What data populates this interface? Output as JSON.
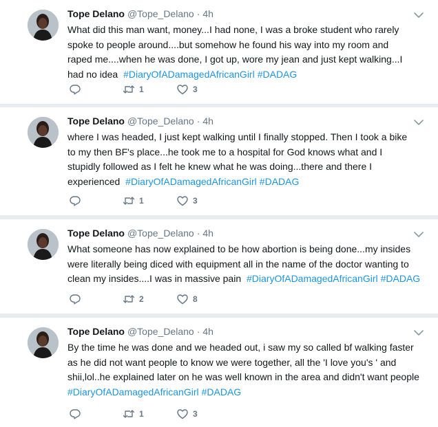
{
  "colors": {
    "name": "#14171a",
    "meta": "#657786",
    "hashtag": "#1b95e0",
    "divider": "#e6ecf0"
  },
  "tweets": [
    {
      "name": "Tope Delano",
      "handle": "@Tope_Delano",
      "separator": "·",
      "time": "4h",
      "text": "What did this man want, money...I had none, I was a broke student who rarely\nspoke to people around....but somehow he found his way into my room and\nraped me....when he was done, I got up, wore my jean and just kept walking...I\nhad no idea ",
      "hashtag1": "#DiaryOfADamagedAfricanGirl",
      "hashtag2": "#DADAG",
      "replies": "",
      "retweets": "1",
      "likes": "3"
    },
    {
      "name": "Tope Delano",
      "handle": "@Tope_Delano",
      "separator": "·",
      "time": "4h",
      "text": "where I was headed, I just kept walking until I finally stopped. Then I took a bike\nto my then BF's place...he took me to a hospital for God knows what and I\nstupidly followed as I felt he knew what he was doing...there and there I\nexperienced ",
      "hashtag1": "#DiaryOfADamagedAfricanGirl",
      "hashtag2": "#DADAG",
      "replies": "",
      "retweets": "1",
      "likes": "3"
    },
    {
      "name": "Tope Delano",
      "handle": "@Tope_Delano",
      "separator": "·",
      "time": "4h",
      "text": "What someone has now explained to be how abortion is being done...my insides\nwere literally being diced with equipment all in the name of the doctor wanting to\nclean my insides....I was in massive pain ",
      "hashtag1": "#DiaryOfADamagedAfricanGirl",
      "hashtag2": "#DADAG",
      "replies": "",
      "retweets": "2",
      "likes": "8"
    },
    {
      "name": "Tope Delano",
      "handle": "@Tope_Delano",
      "separator": "·",
      "time": "4h",
      "text": "By the time he was done and we headed out, i saw my so called bf walking faster\nas he did not want people to know we were together, all the 'I love you's ' and\nshii,lol..he explained later on he was well known in the area and didn't want people\n",
      "hashtag1": "#DiaryOfADamagedAfricanGirl",
      "hashtag2": "#DADAG",
      "replies": "",
      "retweets": "1",
      "likes": "3"
    }
  ]
}
